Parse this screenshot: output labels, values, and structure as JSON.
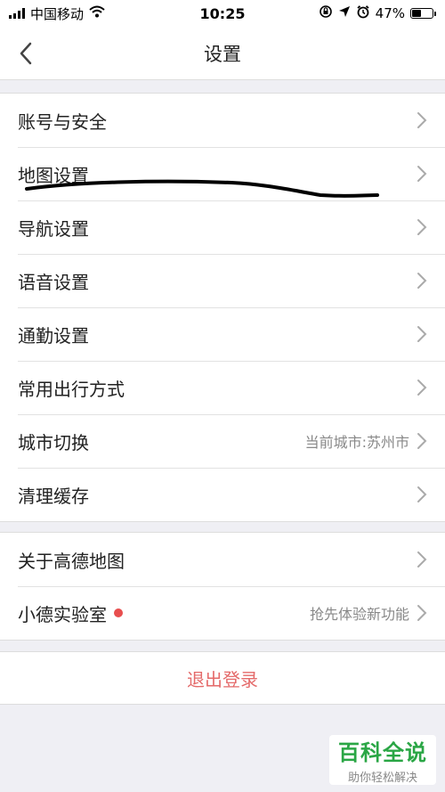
{
  "status_bar": {
    "carrier": "中国移动",
    "time": "10:25",
    "battery_percent_text": "47%",
    "battery_level": 0.47,
    "icons": [
      "signal-icon",
      "wifi-icon",
      "rotation-lock-icon",
      "location-icon",
      "alarm-icon",
      "battery-icon"
    ]
  },
  "nav": {
    "title": "设置",
    "back_icon": "chevron-left-icon"
  },
  "group1": {
    "items": [
      {
        "label": "账号与安全"
      },
      {
        "label": "地图设置"
      },
      {
        "label": "导航设置"
      },
      {
        "label": "语音设置"
      },
      {
        "label": "通勤设置"
      },
      {
        "label": "常用出行方式"
      },
      {
        "label": "城市切换",
        "value": "当前城市:苏州市"
      },
      {
        "label": "清理缓存"
      }
    ]
  },
  "group2": {
    "items": [
      {
        "label": "关于高德地图"
      },
      {
        "label": "小德实验室",
        "value": "抢先体验新功能",
        "badge": "red-dot"
      }
    ]
  },
  "logout": {
    "label": "退出登录"
  },
  "colors": {
    "background": "#efeff4",
    "logout_text": "#e46a6a",
    "badge_red": "#e84e4e",
    "watermark_green": "#2aa645"
  },
  "watermark": {
    "title": "百科全说",
    "subtitle": "助你轻松解决"
  }
}
